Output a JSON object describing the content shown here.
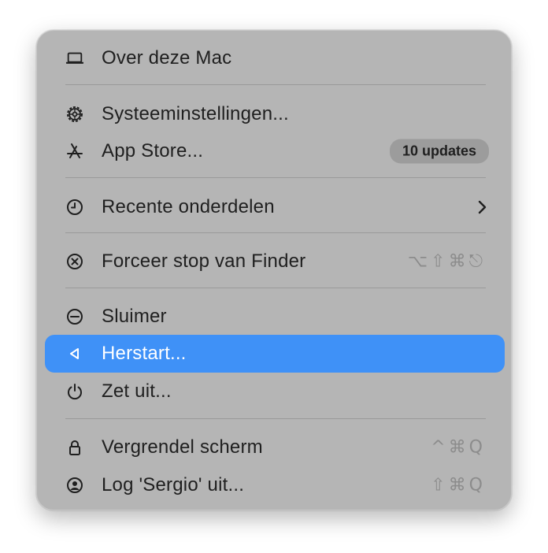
{
  "menu": {
    "items": [
      {
        "label": "Over deze Mac",
        "icon": "laptop-icon"
      },
      {
        "label": "Systeeminstellingen...",
        "icon": "gear-icon"
      },
      {
        "label": "App Store...",
        "icon": "app-store-icon",
        "badge": "10 updates"
      },
      {
        "label": "Recente onderdelen",
        "icon": "clock-icon",
        "submenu": "chevron-right-icon"
      },
      {
        "label": "Forceer stop van Finder",
        "icon": "force-quit-icon",
        "shortcut": "⌥⇧⌘⎋"
      },
      {
        "label": "Sluimer",
        "icon": "sleep-icon"
      },
      {
        "label": "Herstart...",
        "icon": "restart-icon",
        "selected": true
      },
      {
        "label": "Zet uit...",
        "icon": "power-icon"
      },
      {
        "label": "Vergrendel scherm",
        "icon": "lock-icon",
        "shortcut": "^⌘Q"
      },
      {
        "label": "Log 'Sergio' uit...",
        "icon": "user-icon",
        "shortcut": "⇧⌘Q"
      }
    ]
  },
  "colors": {
    "menu_background": "#b5b5b5",
    "selection": "#3f91f7",
    "text": "#1f1f1f",
    "shortcut_text": "#8c8c8c",
    "badge_background": "#9c9c9c"
  }
}
